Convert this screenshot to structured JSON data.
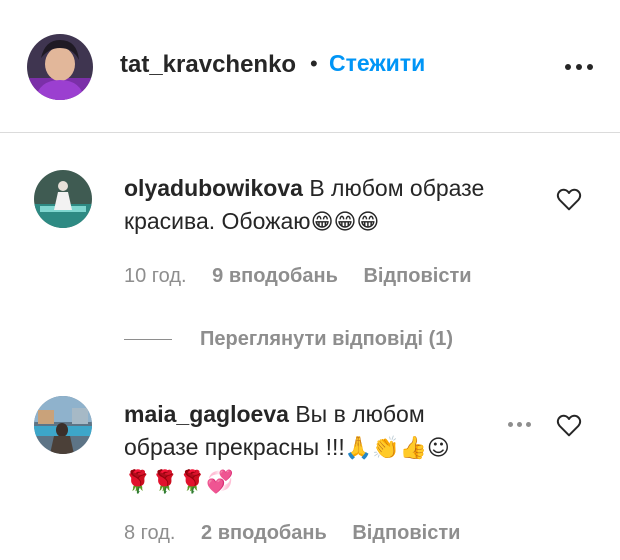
{
  "post": {
    "username": "tat_kravchenko",
    "separator": "•",
    "follow_label": "Стежити"
  },
  "comments": [
    {
      "username": "olyadubowikova",
      "text": "В любом образе красива. Обожаю",
      "emoji": "😁😁😁",
      "time": "10 год.",
      "likes": "9 вподобань",
      "reply_label": "Відповісти"
    },
    {
      "username": "maia_gagloeva",
      "text": "Вы в любом образе прекрасны !!!",
      "emoji": "🙏👏👍☺",
      "emoji_line2": "🌹🌹🌹💞",
      "time": "8 год.",
      "likes": "2 вподобань",
      "reply_label": "Відповісти"
    }
  ],
  "view_replies_label": "Переглянути відповіді (1)",
  "colors": {
    "accent": "#0095f6",
    "text": "#262626",
    "muted": "#8e8e8e",
    "divider": "#dbdbdb"
  },
  "icons": {
    "more": "more-horizontal-icon",
    "like": "heart-outline-icon"
  }
}
